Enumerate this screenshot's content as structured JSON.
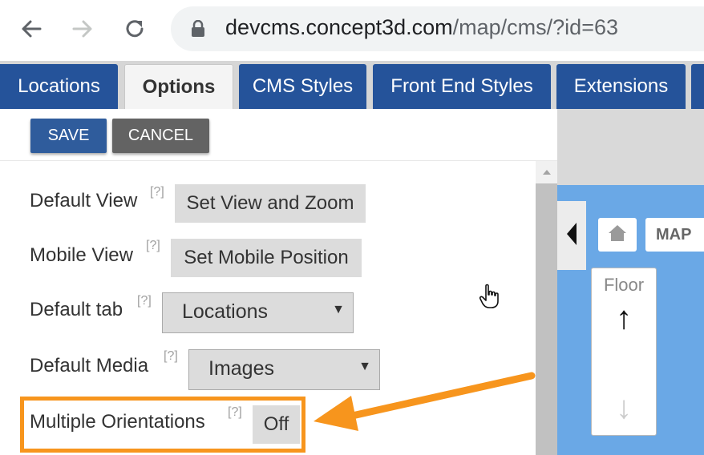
{
  "browser": {
    "url_host": "devcms.concept3d.com",
    "url_path": "/map/cms/?id=63"
  },
  "tabs": [
    {
      "label": "Locations",
      "active": false
    },
    {
      "label": "Options",
      "active": true
    },
    {
      "label": "CMS Styles",
      "active": false
    },
    {
      "label": "Front End Styles",
      "active": false
    },
    {
      "label": "Extensions",
      "active": false
    }
  ],
  "toolbar": {
    "save_label": "SAVE",
    "cancel_label": "CANCEL"
  },
  "options": {
    "help_marker": "[?]",
    "default_view": {
      "label": "Default View",
      "button": "Set View and Zoom"
    },
    "mobile_view": {
      "label": "Mobile View",
      "button": "Set Mobile Position"
    },
    "default_tab": {
      "label": "Default tab",
      "selected": "Locations"
    },
    "default_media": {
      "label": "Default Media",
      "selected": "Images"
    },
    "multiple_orientations": {
      "label": "Multiple Orientations",
      "value": "Off"
    }
  },
  "map": {
    "map_button": "MAP",
    "floor_label": "Floor",
    "arrow_up": "↑",
    "arrow_down": "↓"
  },
  "colors": {
    "tab_blue": "#25539a",
    "save_blue": "#2f5c9c",
    "cancel_gray": "#636363",
    "map_water": "#6aa8e6",
    "highlight_orange": "#f7951d"
  },
  "icons": [
    "back-arrow-icon",
    "forward-arrow-icon",
    "reload-icon",
    "lock-icon",
    "scroll-up-icon",
    "chevron-left-icon",
    "home-icon",
    "pointer-hand-icon"
  ]
}
